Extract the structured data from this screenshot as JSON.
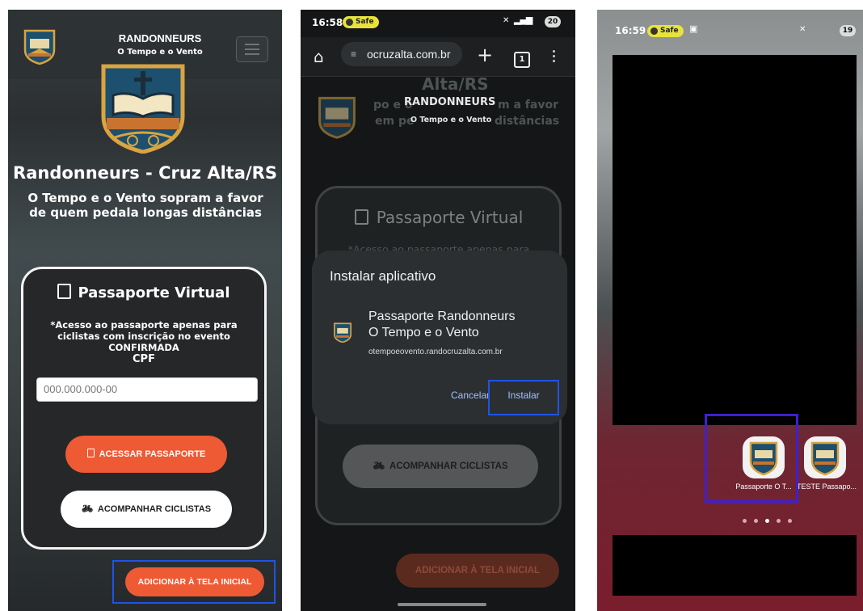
{
  "screen1": {
    "brand_title": "RANDONNEURS",
    "brand_subtitle": "O Tempo e o Vento",
    "hero_title": "Randonneurs - Cruz Alta/RS",
    "hero_subtitle": "O Tempo e o Vento sopram a favor de quem pedala longas distâncias",
    "card": {
      "title": "Passaporte Virtual",
      "note": "*Acesso ao passaporte apenas para ciclistas com inscrição no evento CONFIRMADA",
      "cpf_label": "CPF",
      "cpf_placeholder": "000.000.000-00",
      "access_button": "ACESSAR PASSAPORTE",
      "follow_button": "ACOMPANHAR CICLISTAS"
    },
    "add_home_button": "ADICIONAR À TELA INICIAL"
  },
  "screen2": {
    "time": "16:58",
    "safe_badge": "Safe",
    "battery": "20",
    "url": "ocruzalta.com.br",
    "tab_count": "1",
    "ghost_title": "Alta/RS",
    "ghost_brand": "RANDONNEURS",
    "ghost_brand_sub": "O Tempo e o Vento",
    "ghost_left": "po e o",
    "ghost_right": "m a favor",
    "ghost_left2": "em pe",
    "ghost_right2": "distâncias",
    "card_title": "Passaporte Virtual",
    "card_note": "*Acesso ao passaporte apenas para",
    "dialog": {
      "title": "Instalar aplicativo",
      "app_name_line1": "Passaporte Randonneurs",
      "app_name_line2": "O Tempo e o Vento",
      "app_url": "otempoeovento.randocruzalta.com.br",
      "cancel": "Cancelar",
      "install": "Instalar"
    },
    "follow_button": "ACOMPANHAR CICLISTAS",
    "add_home_button": "ADICIONAR À TELA INICIAL"
  },
  "screen3": {
    "time": "16:59",
    "safe_badge": "Safe",
    "battery": "19",
    "app1_label": "Passaporte O T...",
    "app2_label": "TESTE Passapo..."
  },
  "colors": {
    "accent_orange": "#ee5a34",
    "highlight_blue": "#1e54e6",
    "highlight_purple": "#3f1fcf",
    "safe_yellow": "#e7e23d"
  }
}
